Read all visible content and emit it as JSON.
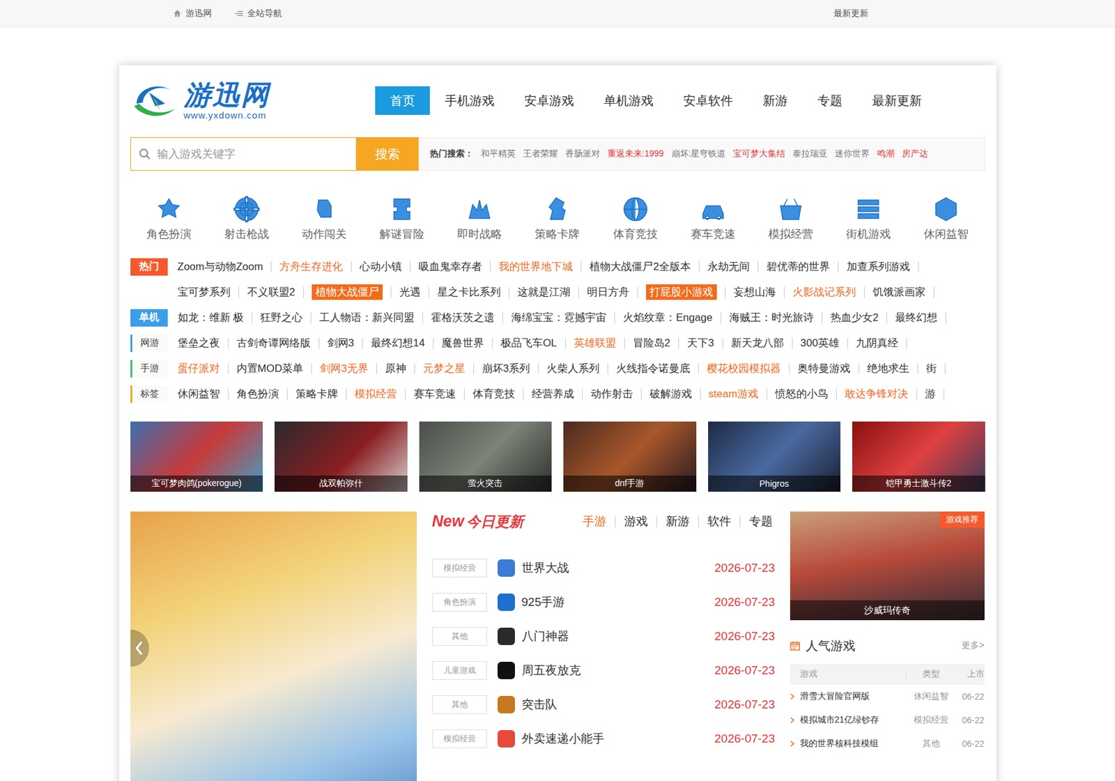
{
  "topbar": {
    "home": "游迅网",
    "sitenav": "全站导航",
    "latest": "最新更新"
  },
  "logo": {
    "title": "游迅网",
    "url": "www.yxdown.com"
  },
  "nav": [
    {
      "label": "首页",
      "selected": true
    },
    {
      "label": "手机游戏",
      "selected": false
    },
    {
      "label": "安卓游戏",
      "selected": false
    },
    {
      "label": "单机游戏",
      "selected": false
    },
    {
      "label": "安卓软件",
      "selected": false
    },
    {
      "label": "新游",
      "selected": false
    },
    {
      "label": "专题",
      "selected": false
    },
    {
      "label": "最新更新",
      "selected": false
    }
  ],
  "search": {
    "placeholder": "输入游戏关键字",
    "button": "搜索",
    "hot_label": "热门搜索：",
    "hot": [
      {
        "text": "和平精英",
        "highlight": false
      },
      {
        "text": "王者荣耀",
        "highlight": false
      },
      {
        "text": "香肠派对",
        "highlight": false
      },
      {
        "text": "重返未来:1999",
        "highlight": true
      },
      {
        "text": "崩坏:星穹铁道",
        "highlight": false
      },
      {
        "text": "宝可梦大集结",
        "highlight": true
      },
      {
        "text": "泰拉瑞亚",
        "highlight": false
      },
      {
        "text": "迷你世界",
        "highlight": false
      },
      {
        "text": "鸣潮",
        "highlight": true
      },
      {
        "text": "房产达",
        "highlight": true
      }
    ]
  },
  "categories": [
    "角色扮演",
    "射击枪战",
    "动作闯关",
    "解谜冒险",
    "即时战略",
    "策略卡牌",
    "体育竞技",
    "赛车竞速",
    "模拟经营",
    "街机游戏",
    "休闲益智"
  ],
  "tag_rows": [
    {
      "label": "热门",
      "kind": "filled",
      "color": "#f55a2c",
      "lines": [
        [
          {
            "text": "Zoom与动物Zoom",
            "kind": "normal"
          },
          {
            "text": "方舟生存进化",
            "kind": "orange"
          },
          {
            "text": "心动小镇",
            "kind": "normal"
          },
          {
            "text": "吸血鬼幸存者",
            "kind": "normal"
          },
          {
            "text": "我的世界地下城",
            "kind": "orange"
          },
          {
            "text": "植物大战僵尸2全版本",
            "kind": "normal"
          },
          {
            "text": "永劫无间",
            "kind": "normal"
          },
          {
            "text": "碧优蒂的世界",
            "kind": "normal"
          },
          {
            "text": "加查系列游戏",
            "kind": "normal"
          }
        ],
        [
          {
            "text": "宝可梦系列",
            "kind": "normal"
          },
          {
            "text": "不义联盟2",
            "kind": "normal"
          },
          {
            "text": "植物大战僵尸",
            "kind": "badge"
          },
          {
            "text": "光遇",
            "kind": "normal"
          },
          {
            "text": "星之卡比系列",
            "kind": "normal"
          },
          {
            "text": "这就是江湖",
            "kind": "normal"
          },
          {
            "text": "明日方舟",
            "kind": "normal"
          },
          {
            "text": "打屁股小游戏",
            "kind": "badge"
          },
          {
            "text": "妄想山海",
            "kind": "normal"
          },
          {
            "text": "火影战记系列",
            "kind": "orange"
          },
          {
            "text": "饥饿派画家",
            "kind": "normal"
          }
        ]
      ]
    },
    {
      "label": "单机",
      "kind": "filled",
      "color": "#3a9ee8",
      "lines": [
        [
          {
            "text": "如龙：维新 极",
            "kind": "normal"
          },
          {
            "text": "狂野之心",
            "kind": "normal"
          },
          {
            "text": "工人物语：新兴同盟",
            "kind": "normal"
          },
          {
            "text": "霍格沃茨之遗",
            "kind": "normal"
          },
          {
            "text": "海绵宝宝：霓撼宇宙",
            "kind": "normal"
          },
          {
            "text": "火焰纹章：Engage",
            "kind": "normal"
          },
          {
            "text": "海贼王：时光旅诗",
            "kind": "normal"
          },
          {
            "text": "热血少女2",
            "kind": "normal"
          },
          {
            "text": "最终幻想",
            "kind": "normal"
          }
        ]
      ]
    },
    {
      "label": "网游",
      "kind": "bar",
      "color": "#3a9ee8",
      "lines": [
        [
          {
            "text": "堡垒之夜",
            "kind": "normal"
          },
          {
            "text": "古剑奇谭网络版",
            "kind": "normal"
          },
          {
            "text": "剑网3",
            "kind": "normal"
          },
          {
            "text": "最终幻想14",
            "kind": "normal"
          },
          {
            "text": "魔兽世界",
            "kind": "normal"
          },
          {
            "text": "极品飞车OL",
            "kind": "normal"
          },
          {
            "text": "英雄联盟",
            "kind": "orange"
          },
          {
            "text": "冒险岛2",
            "kind": "normal"
          },
          {
            "text": "天下3",
            "kind": "normal"
          },
          {
            "text": "新天龙八部",
            "kind": "normal"
          },
          {
            "text": "300英雄",
            "kind": "normal"
          },
          {
            "text": "九阴真经",
            "kind": "normal"
          }
        ]
      ]
    },
    {
      "label": "手游",
      "kind": "bar",
      "color": "#3cc06a",
      "lines": [
        [
          {
            "text": "蛋仔派对",
            "kind": "orange"
          },
          {
            "text": "内置MOD菜单",
            "kind": "normal"
          },
          {
            "text": "剑网3无界",
            "kind": "orange"
          },
          {
            "text": "原神",
            "kind": "normal"
          },
          {
            "text": "元梦之星",
            "kind": "orange"
          },
          {
            "text": "崩坏3系列",
            "kind": "normal"
          },
          {
            "text": "火柴人系列",
            "kind": "normal"
          },
          {
            "text": "火线指令诺曼底",
            "kind": "normal"
          },
          {
            "text": "樱花校园模拟器",
            "kind": "orange"
          },
          {
            "text": "奥特曼游戏",
            "kind": "normal"
          },
          {
            "text": "绝地求生",
            "kind": "normal"
          },
          {
            "text": "街",
            "kind": "normal"
          }
        ]
      ]
    },
    {
      "label": "标签",
      "kind": "bar",
      "color": "#f5a623",
      "lines": [
        [
          {
            "text": "休闲益智",
            "kind": "normal"
          },
          {
            "text": "角色扮演",
            "kind": "normal"
          },
          {
            "text": "策略卡牌",
            "kind": "normal"
          },
          {
            "text": "模拟经营",
            "kind": "orange"
          },
          {
            "text": "赛车竞速",
            "kind": "normal"
          },
          {
            "text": "体育竞技",
            "kind": "normal"
          },
          {
            "text": "经营养成",
            "kind": "normal"
          },
          {
            "text": "动作射击",
            "kind": "normal"
          },
          {
            "text": "破解游戏",
            "kind": "normal"
          },
          {
            "text": "steam游戏",
            "kind": "orange"
          },
          {
            "text": "愤怒的小鸟",
            "kind": "normal"
          },
          {
            "text": "敢达争锋对决",
            "kind": "orange"
          },
          {
            "text": "游",
            "kind": "normal"
          }
        ]
      ]
    }
  ],
  "featured": [
    "宝可梦肉鸽(pokerogue)",
    "战双帕弥什",
    "萤火突击",
    "dnf手游",
    "Phigros",
    "铠甲勇士激斗传2"
  ],
  "today": {
    "title_new": "New",
    "title": "今日更新",
    "tabs": [
      {
        "label": "手游",
        "selected": true
      },
      {
        "label": "游戏",
        "selected": false
      },
      {
        "label": "新游",
        "selected": false
      },
      {
        "label": "软件",
        "selected": false
      },
      {
        "label": "专题",
        "selected": false
      }
    ],
    "rows": [
      {
        "tag": "模拟经营",
        "name": "世界大战",
        "date": "2026-07-23"
      },
      {
        "tag": "角色扮演",
        "name": "925手游",
        "date": "2026-07-23"
      },
      {
        "tag": "其他",
        "name": "八门神器",
        "date": "2026-07-23"
      },
      {
        "tag": "儿童游戏",
        "name": "周五夜放克",
        "date": "2026-07-23"
      },
      {
        "tag": "其他",
        "name": "突击队",
        "date": "2026-07-23"
      },
      {
        "tag": "模拟经营",
        "name": "外卖速递小能手",
        "date": "2026-07-23"
      }
    ]
  },
  "recommend": {
    "badge": "游戏推荐",
    "caption": "沙威玛传奇"
  },
  "popular": {
    "title": "人气游戏",
    "more": "更多>",
    "columns": [
      "游戏",
      "类型",
      "上市"
    ],
    "rows": [
      {
        "name": "滑雪大冒险官网版",
        "type": "休闲益智",
        "date": "06-22"
      },
      {
        "name": "模拟城市21亿绿钞存",
        "type": "模拟经营",
        "date": "06-22"
      },
      {
        "name": "我的世界核科技模组",
        "type": "其他",
        "date": "06-22"
      }
    ]
  }
}
